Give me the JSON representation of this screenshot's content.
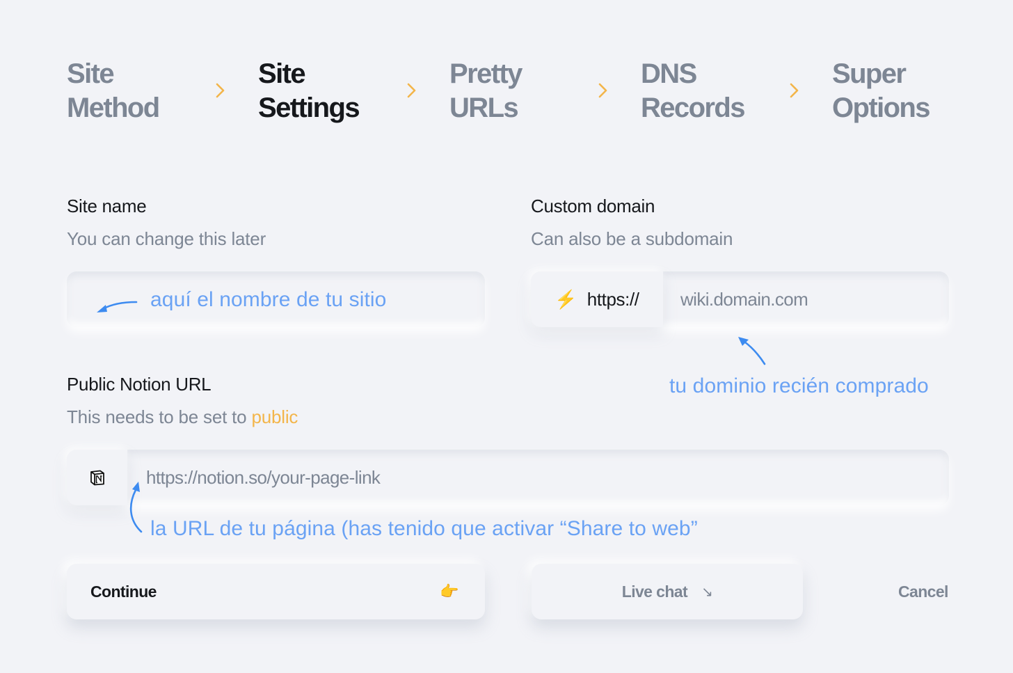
{
  "stepper": {
    "steps": [
      {
        "line1": "Site",
        "line2": "Method",
        "active": false
      },
      {
        "line1": "Site",
        "line2": "Settings",
        "active": true
      },
      {
        "line1": "Pretty",
        "line2": "URLs",
        "active": false
      },
      {
        "line1": "DNS",
        "line2": "Records",
        "active": false
      },
      {
        "line1": "Super",
        "line2": "Options",
        "active": false
      }
    ],
    "separator_icon": "chevron-right-icon"
  },
  "site_name": {
    "label": "Site name",
    "hint": "You can change this later",
    "value": "",
    "placeholder": "",
    "annotation": "aquí el nombre de tu sitio"
  },
  "custom_domain": {
    "label": "Custom domain",
    "hint": "Can also be a subdomain",
    "prefix_icon": "lightning-icon",
    "prefix_icon_glyph": "⚡",
    "prefix_text": "https://",
    "value": "",
    "placeholder": "wiki.domain.com",
    "annotation": "tu dominio recién comprado"
  },
  "notion_url": {
    "label": "Public Notion URL",
    "hint_text": "This needs to be set to ",
    "hint_accent": "public",
    "prefix_icon": "notion-logo-icon",
    "value": "",
    "placeholder": "https://notion.so/your-page-link",
    "annotation": "la URL de tu página (has tenido que activar “Share to web”"
  },
  "actions": {
    "continue_label": "Continue",
    "continue_icon": "👉",
    "live_chat_label": "Live chat",
    "live_chat_icon": "↘",
    "cancel_label": "Cancel"
  },
  "colors": {
    "background": "#f2f3f7",
    "text_primary": "#16181c",
    "text_muted": "#7d8694",
    "accent_orange": "#f3b54a",
    "annotation_blue": "#6aa2f4"
  }
}
